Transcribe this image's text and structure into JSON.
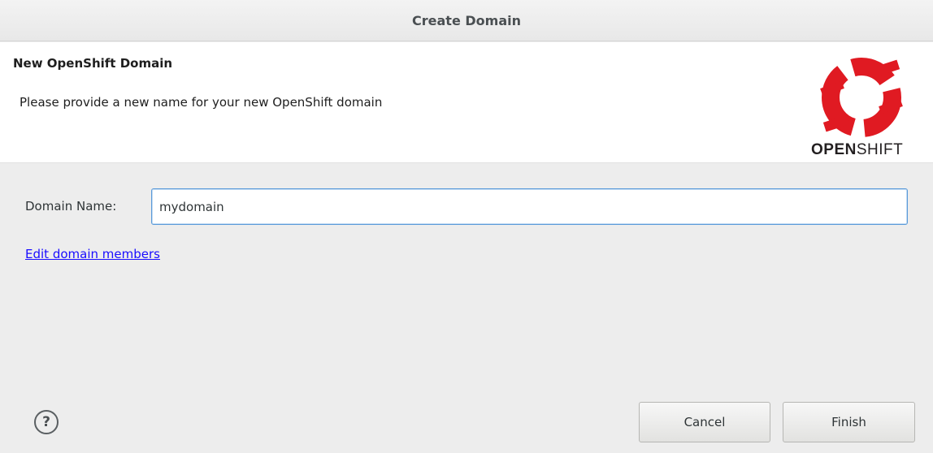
{
  "window": {
    "title": "Create Domain"
  },
  "banner": {
    "heading": "New OpenShift Domain",
    "description": "Please provide a new name for your new OpenShift domain",
    "logo": {
      "icon": "openshift-logo-icon",
      "text_bold": "OPEN",
      "text_regular": "SHIFT",
      "color": "#e01a22"
    }
  },
  "form": {
    "domain_name_label": "Domain Name:",
    "domain_name_value": "mydomain",
    "edit_members_link": "Edit domain members"
  },
  "footer": {
    "help_icon": "help-icon",
    "help_glyph": "?",
    "cancel_label": "Cancel",
    "finish_label": "Finish"
  },
  "colors": {
    "link": "#1a0dff",
    "focus_border": "#5a9ad9",
    "logo_red": "#e01a22"
  }
}
